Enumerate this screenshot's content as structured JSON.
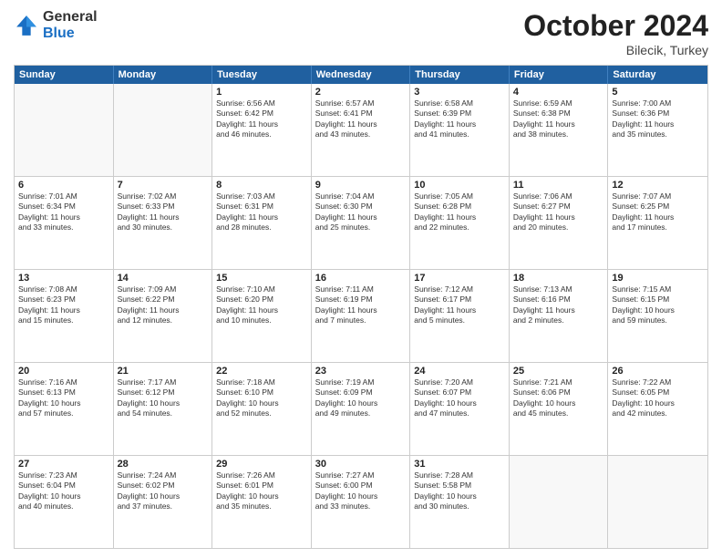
{
  "logo": {
    "general": "General",
    "blue": "Blue"
  },
  "title": "October 2024",
  "subtitle": "Bilecik, Turkey",
  "days": [
    "Sunday",
    "Monday",
    "Tuesday",
    "Wednesday",
    "Thursday",
    "Friday",
    "Saturday"
  ],
  "rows": [
    [
      {
        "day": "",
        "lines": [],
        "empty": true
      },
      {
        "day": "",
        "lines": [],
        "empty": true
      },
      {
        "day": "1",
        "lines": [
          "Sunrise: 6:56 AM",
          "Sunset: 6:42 PM",
          "Daylight: 11 hours",
          "and 46 minutes."
        ]
      },
      {
        "day": "2",
        "lines": [
          "Sunrise: 6:57 AM",
          "Sunset: 6:41 PM",
          "Daylight: 11 hours",
          "and 43 minutes."
        ]
      },
      {
        "day": "3",
        "lines": [
          "Sunrise: 6:58 AM",
          "Sunset: 6:39 PM",
          "Daylight: 11 hours",
          "and 41 minutes."
        ]
      },
      {
        "day": "4",
        "lines": [
          "Sunrise: 6:59 AM",
          "Sunset: 6:38 PM",
          "Daylight: 11 hours",
          "and 38 minutes."
        ]
      },
      {
        "day": "5",
        "lines": [
          "Sunrise: 7:00 AM",
          "Sunset: 6:36 PM",
          "Daylight: 11 hours",
          "and 35 minutes."
        ]
      }
    ],
    [
      {
        "day": "6",
        "lines": [
          "Sunrise: 7:01 AM",
          "Sunset: 6:34 PM",
          "Daylight: 11 hours",
          "and 33 minutes."
        ]
      },
      {
        "day": "7",
        "lines": [
          "Sunrise: 7:02 AM",
          "Sunset: 6:33 PM",
          "Daylight: 11 hours",
          "and 30 minutes."
        ]
      },
      {
        "day": "8",
        "lines": [
          "Sunrise: 7:03 AM",
          "Sunset: 6:31 PM",
          "Daylight: 11 hours",
          "and 28 minutes."
        ]
      },
      {
        "day": "9",
        "lines": [
          "Sunrise: 7:04 AM",
          "Sunset: 6:30 PM",
          "Daylight: 11 hours",
          "and 25 minutes."
        ]
      },
      {
        "day": "10",
        "lines": [
          "Sunrise: 7:05 AM",
          "Sunset: 6:28 PM",
          "Daylight: 11 hours",
          "and 22 minutes."
        ]
      },
      {
        "day": "11",
        "lines": [
          "Sunrise: 7:06 AM",
          "Sunset: 6:27 PM",
          "Daylight: 11 hours",
          "and 20 minutes."
        ]
      },
      {
        "day": "12",
        "lines": [
          "Sunrise: 7:07 AM",
          "Sunset: 6:25 PM",
          "Daylight: 11 hours",
          "and 17 minutes."
        ]
      }
    ],
    [
      {
        "day": "13",
        "lines": [
          "Sunrise: 7:08 AM",
          "Sunset: 6:23 PM",
          "Daylight: 11 hours",
          "and 15 minutes."
        ]
      },
      {
        "day": "14",
        "lines": [
          "Sunrise: 7:09 AM",
          "Sunset: 6:22 PM",
          "Daylight: 11 hours",
          "and 12 minutes."
        ]
      },
      {
        "day": "15",
        "lines": [
          "Sunrise: 7:10 AM",
          "Sunset: 6:20 PM",
          "Daylight: 11 hours",
          "and 10 minutes."
        ]
      },
      {
        "day": "16",
        "lines": [
          "Sunrise: 7:11 AM",
          "Sunset: 6:19 PM",
          "Daylight: 11 hours",
          "and 7 minutes."
        ]
      },
      {
        "day": "17",
        "lines": [
          "Sunrise: 7:12 AM",
          "Sunset: 6:17 PM",
          "Daylight: 11 hours",
          "and 5 minutes."
        ]
      },
      {
        "day": "18",
        "lines": [
          "Sunrise: 7:13 AM",
          "Sunset: 6:16 PM",
          "Daylight: 11 hours",
          "and 2 minutes."
        ]
      },
      {
        "day": "19",
        "lines": [
          "Sunrise: 7:15 AM",
          "Sunset: 6:15 PM",
          "Daylight: 10 hours",
          "and 59 minutes."
        ]
      }
    ],
    [
      {
        "day": "20",
        "lines": [
          "Sunrise: 7:16 AM",
          "Sunset: 6:13 PM",
          "Daylight: 10 hours",
          "and 57 minutes."
        ]
      },
      {
        "day": "21",
        "lines": [
          "Sunrise: 7:17 AM",
          "Sunset: 6:12 PM",
          "Daylight: 10 hours",
          "and 54 minutes."
        ]
      },
      {
        "day": "22",
        "lines": [
          "Sunrise: 7:18 AM",
          "Sunset: 6:10 PM",
          "Daylight: 10 hours",
          "and 52 minutes."
        ]
      },
      {
        "day": "23",
        "lines": [
          "Sunrise: 7:19 AM",
          "Sunset: 6:09 PM",
          "Daylight: 10 hours",
          "and 49 minutes."
        ]
      },
      {
        "day": "24",
        "lines": [
          "Sunrise: 7:20 AM",
          "Sunset: 6:07 PM",
          "Daylight: 10 hours",
          "and 47 minutes."
        ]
      },
      {
        "day": "25",
        "lines": [
          "Sunrise: 7:21 AM",
          "Sunset: 6:06 PM",
          "Daylight: 10 hours",
          "and 45 minutes."
        ]
      },
      {
        "day": "26",
        "lines": [
          "Sunrise: 7:22 AM",
          "Sunset: 6:05 PM",
          "Daylight: 10 hours",
          "and 42 minutes."
        ]
      }
    ],
    [
      {
        "day": "27",
        "lines": [
          "Sunrise: 7:23 AM",
          "Sunset: 6:04 PM",
          "Daylight: 10 hours",
          "and 40 minutes."
        ]
      },
      {
        "day": "28",
        "lines": [
          "Sunrise: 7:24 AM",
          "Sunset: 6:02 PM",
          "Daylight: 10 hours",
          "and 37 minutes."
        ]
      },
      {
        "day": "29",
        "lines": [
          "Sunrise: 7:26 AM",
          "Sunset: 6:01 PM",
          "Daylight: 10 hours",
          "and 35 minutes."
        ]
      },
      {
        "day": "30",
        "lines": [
          "Sunrise: 7:27 AM",
          "Sunset: 6:00 PM",
          "Daylight: 10 hours",
          "and 33 minutes."
        ]
      },
      {
        "day": "31",
        "lines": [
          "Sunrise: 7:28 AM",
          "Sunset: 5:58 PM",
          "Daylight: 10 hours",
          "and 30 minutes."
        ]
      },
      {
        "day": "",
        "lines": [],
        "empty": true
      },
      {
        "day": "",
        "lines": [],
        "empty": true
      }
    ]
  ]
}
